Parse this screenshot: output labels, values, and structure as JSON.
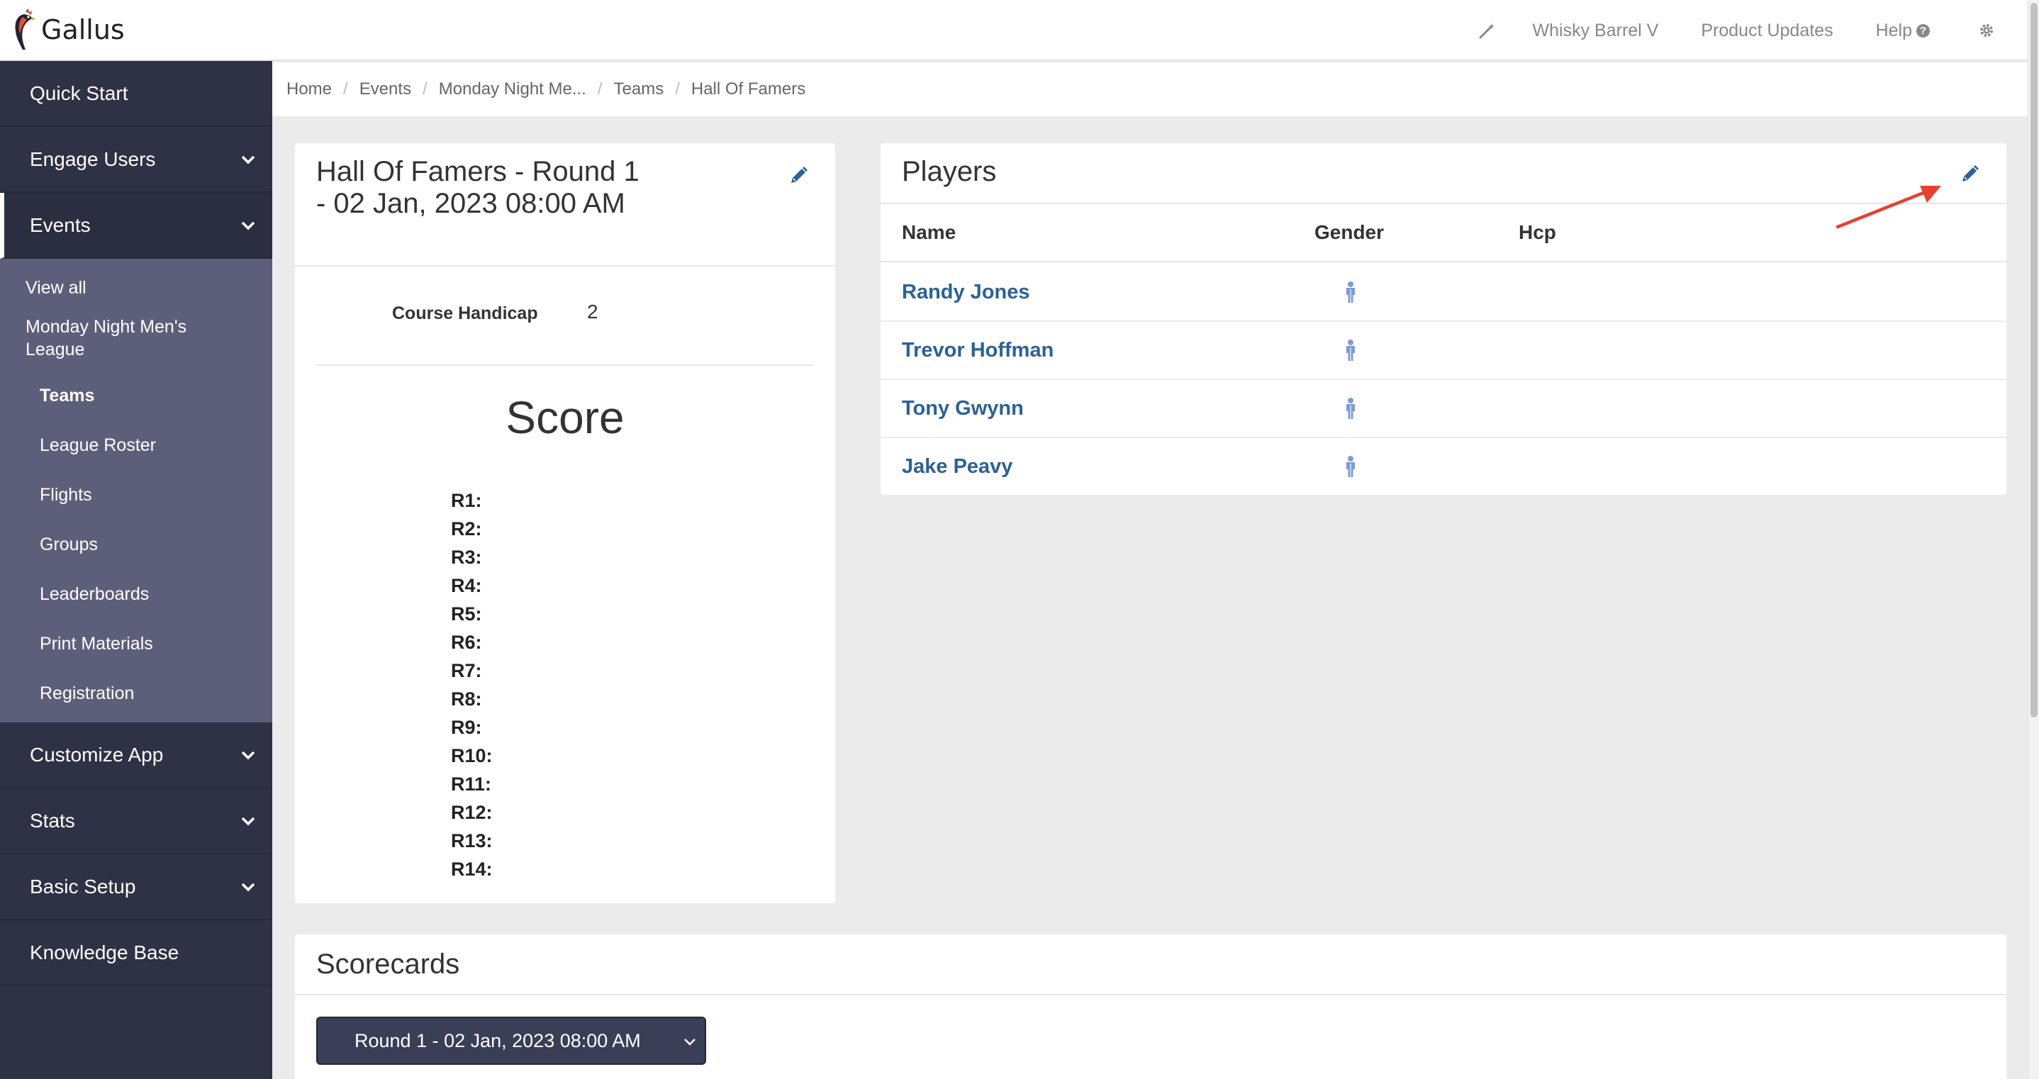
{
  "app": {
    "logo_text": "Gallus"
  },
  "topbar": {
    "org_name": "Whisky Barrel V",
    "product_updates": "Product Updates",
    "help": "Help"
  },
  "sidebar": {
    "quick_start": "Quick Start",
    "engage_users": "Engage Users",
    "events": "Events",
    "events_sub": {
      "view_all": "View all",
      "league_line1": "Monday Night Men's",
      "league_line2": "League",
      "teams": "Teams",
      "league_roster": "League Roster",
      "flights": "Flights",
      "groups": "Groups",
      "leaderboards": "Leaderboards",
      "print_materials": "Print Materials",
      "registration": "Registration"
    },
    "customize_app": "Customize App",
    "stats": "Stats",
    "basic_setup": "Basic Setup",
    "knowledge_base": "Knowledge Base"
  },
  "breadcrumb": [
    "Home",
    "Events",
    "Monday Night Me...",
    "Teams",
    "Hall Of Famers"
  ],
  "team": {
    "title": "Hall Of Famers - Round 1 - 02 Jan, 2023 08:00 AM",
    "course_handicap_label": "Course Handicap",
    "course_handicap_value": "2",
    "score_heading": "Score",
    "rounds": [
      "R1:",
      "R2:",
      "R3:",
      "R4:",
      "R5:",
      "R6:",
      "R7:",
      "R8:",
      "R9:",
      "R10:",
      "R11:",
      "R12:",
      "R13:",
      "R14:"
    ]
  },
  "players": {
    "title": "Players",
    "columns": [
      "Name",
      "Gender",
      "Hcp"
    ],
    "rows": [
      {
        "name": "Randy Jones",
        "gender_icon": "male-icon",
        "hcp": ""
      },
      {
        "name": "Trevor Hoffman",
        "gender_icon": "male-icon",
        "hcp": ""
      },
      {
        "name": "Tony Gwynn",
        "gender_icon": "male-icon",
        "hcp": ""
      },
      {
        "name": "Jake Peavy",
        "gender_icon": "male-icon",
        "hcp": ""
      }
    ]
  },
  "scorecards": {
    "title": "Scorecards",
    "selected_round": "Round 1 - 02 Jan, 2023 08:00 AM"
  },
  "colors": {
    "sidebar_bg": "#2f3145",
    "subnav_bg": "#5d5f7a",
    "link": "#2c6196",
    "edit_icon": "#2c6196",
    "annotation_arrow": "#e8402f",
    "gender_icon": "#7b9be0"
  }
}
